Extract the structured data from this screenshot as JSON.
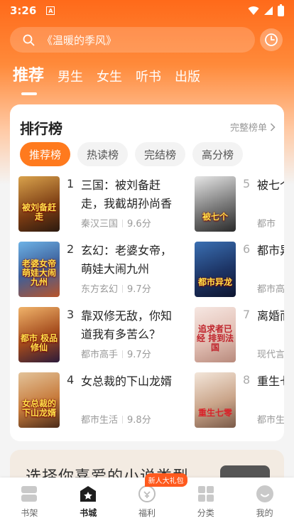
{
  "status_bar": {
    "time": "3:26"
  },
  "search": {
    "placeholder": "《温暖的季风》"
  },
  "tabs": [
    {
      "label": "推荐",
      "active": true
    },
    {
      "label": "男生"
    },
    {
      "label": "女生"
    },
    {
      "label": "听书"
    },
    {
      "label": "出版"
    }
  ],
  "ranking": {
    "title": "排行榜",
    "more_label": "完整榜单",
    "chips": [
      "推荐榜",
      "热读榜",
      "完结榜",
      "高分榜"
    ],
    "books": [
      {
        "rank": "1",
        "title": "三国：被刘备赶走，我截胡孙尚香",
        "genre": "秦汉三国",
        "score": "9.6分",
        "cover_text": "被刘备赶走"
      },
      {
        "rank": "2",
        "title": "玄幻：老婆女帝，萌娃大闹九州",
        "genre": "东方玄幻",
        "score": "9.7分",
        "cover_text": "老婆女帝 萌娃大闹九州"
      },
      {
        "rank": "3",
        "title": "靠双修无敌，你知道我有多苦么？",
        "genre": "都市高手",
        "score": "9.7分",
        "cover_text": "都市 极品修仙"
      },
      {
        "rank": "4",
        "title": "女总裁的下山龙婿",
        "genre": "都市生活",
        "score": "9.8分",
        "cover_text": "女总裁的 下山龙婿"
      },
      {
        "rank": "5",
        "title": "被七个",
        "genre": "都市",
        "score": "",
        "cover_text": "被七个"
      },
      {
        "rank": "6",
        "title": "都市异",
        "genre": "都市高",
        "score": "",
        "cover_text": "都市异龙"
      },
      {
        "rank": "7",
        "title": "离婚而 追求者",
        "genre": "现代言",
        "score": "",
        "cover_text": "追求者已经 排到法国"
      },
      {
        "rank": "8",
        "title": "重生七 猎养妻",
        "genre": "都市生",
        "score": "",
        "cover_text": "重生七零"
      }
    ]
  },
  "promo": {
    "text": "选择你喜爱的小说类型"
  },
  "bottom_nav": [
    {
      "label": "书架"
    },
    {
      "label": "书城",
      "active": true
    },
    {
      "label": "福利",
      "badge": "新人大礼包"
    },
    {
      "label": "分类"
    },
    {
      "label": "我的"
    }
  ],
  "colors": {
    "accent": "#ff7a1e",
    "header": "#ff6a1a"
  }
}
